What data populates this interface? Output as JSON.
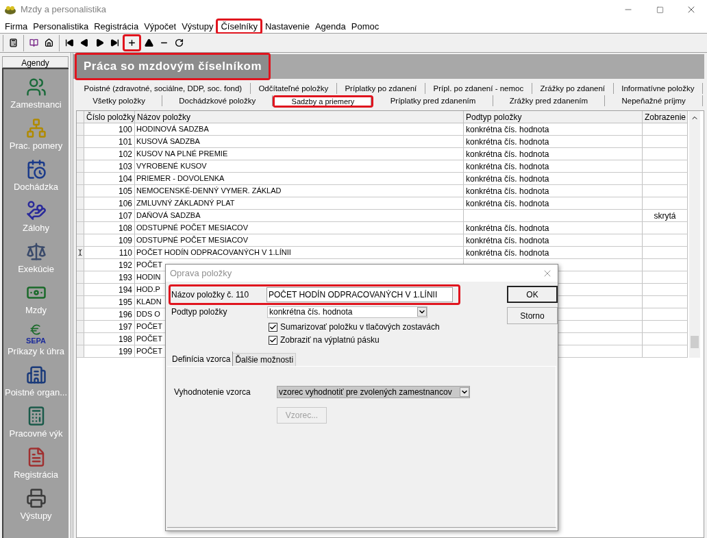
{
  "window": {
    "title": "Mzdy a personalistika"
  },
  "menu": [
    {
      "label": "Firma",
      "highlighted": false
    },
    {
      "label": "Personalistika",
      "highlighted": false
    },
    {
      "label": "Registrácia",
      "highlighted": false
    },
    {
      "label": "Výpočet",
      "highlighted": false
    },
    {
      "label": "Výstupy",
      "highlighted": false
    },
    {
      "label": "Číselníky",
      "highlighted": true
    },
    {
      "label": "Nastavenie",
      "highlighted": false
    },
    {
      "label": "Agenda",
      "highlighted": false
    },
    {
      "label": "Pomoc",
      "highlighted": false
    }
  ],
  "toolbar": {
    "groups": [
      {
        "buttons": [
          {
            "kind": "calculator",
            "highlighted": false
          }
        ]
      },
      {
        "buttons": [
          {
            "kind": "book",
            "highlighted": false
          },
          {
            "kind": "home",
            "highlighted": false
          }
        ]
      },
      {
        "buttons": [
          {
            "kind": "first",
            "highlighted": false
          },
          {
            "kind": "prev",
            "highlighted": false
          },
          {
            "kind": "next",
            "highlighted": false
          },
          {
            "kind": "last",
            "highlighted": false
          },
          {
            "kind": "add",
            "highlighted": true
          },
          {
            "kind": "up",
            "highlighted": false
          },
          {
            "kind": "remove",
            "highlighted": false
          },
          {
            "kind": "refresh",
            "highlighted": false
          }
        ]
      }
    ]
  },
  "sidebar": {
    "header": "Agendy",
    "items": [
      {
        "label": "Zamestnanci"
      },
      {
        "label": "Prac. pomery"
      },
      {
        "label": "Dochádzka"
      },
      {
        "label": "Zálohy"
      },
      {
        "label": "Exekúcie"
      },
      {
        "label": "Mzdy"
      },
      {
        "label": "Príkazy k úhra",
        "badge": "SEPA"
      },
      {
        "label": "Poistné organ..."
      },
      {
        "label": "Pracovné výk"
      },
      {
        "label": "Registrácia"
      },
      {
        "label": "Výstupy"
      }
    ]
  },
  "header": {
    "title": "Práca so mzdovým číselníkom",
    "highlighted": true
  },
  "tabs": {
    "upper": [
      {
        "label": "Poistné (zdravotné, sociálne, DDP, soc. fond)",
        "selected": false,
        "highlighted": false
      },
      {
        "label": "Odčítateľné položky",
        "selected": false,
        "highlighted": false
      },
      {
        "label": "Príplatky po zdanení",
        "selected": false,
        "highlighted": false
      },
      {
        "label": "Prípl. po zdanení - nemoc",
        "selected": false,
        "highlighted": false
      },
      {
        "label": "Zrážky po zdanení",
        "selected": false,
        "highlighted": false
      },
      {
        "label": "Informatívne položky",
        "selected": false,
        "highlighted": false
      }
    ],
    "lower": [
      {
        "label": "Všetky položky",
        "selected": false,
        "highlighted": false
      },
      {
        "label": "Dochádzkové položky",
        "selected": false,
        "highlighted": false
      },
      {
        "label": "Sadzby a priemery",
        "selected": true,
        "highlighted": true
      },
      {
        "label": "Príplatky pred zdanením",
        "selected": false,
        "highlighted": false
      },
      {
        "label": "Zrážky pred zdanením",
        "selected": false,
        "highlighted": false
      },
      {
        "label": "Nepeňažné príjmy",
        "selected": false,
        "highlighted": false
      }
    ]
  },
  "table": {
    "columns": [
      "Číslo položky",
      "Názov položky",
      "Podtyp položky",
      "Zobrazenie"
    ],
    "rows": [
      {
        "number": "100",
        "name": "HODINOVÁ SADZBA",
        "subtype": "konkrétna čís. hodnota",
        "current": false
      },
      {
        "number": "101",
        "name": "KUSOVÁ SADZBA",
        "subtype": "konkrétna čís. hodnota",
        "current": false
      },
      {
        "number": "102",
        "name": "KUSOV NA PLNÉ PREMIE",
        "subtype": "konkrétna čís. hodnota",
        "current": false
      },
      {
        "number": "103",
        "name": "VYROBENÉ KUSOV",
        "subtype": "konkrétna čís. hodnota",
        "current": false
      },
      {
        "number": "104",
        "name": "PRIEMER - DOVOLENKA",
        "subtype": "konkrétna čís. hodnota",
        "current": false
      },
      {
        "number": "105",
        "name": "NEMOCENSKÉ-DENNÝ VYMER. ZÁKLAD",
        "subtype": "konkrétna čís. hodnota",
        "current": false
      },
      {
        "number": "106",
        "name": "ZMLUVNÝ ZÁKLADNÝ PLAT",
        "subtype": "konkrétna čís. hodnota",
        "current": false
      },
      {
        "number": "107",
        "name": "DAŇOVÁ SADZBA",
        "display": "skrytá",
        "current": false
      },
      {
        "number": "108",
        "name": "ODSTUPNÉ POČET MESIACOV",
        "subtype": "konkrétna čís. hodnota",
        "current": false
      },
      {
        "number": "109",
        "name": "ODSTUPNÉ POČET MESIACOV",
        "subtype": "konkrétna čís. hodnota",
        "current": false
      },
      {
        "number": "110",
        "name": "POČET HODÍN ODPRACOVANÝCH V 1.LÍNII",
        "subtype": "konkrétna čís. hodnota",
        "current": true
      },
      {
        "number": "192",
        "name": "POČET",
        "current": false
      },
      {
        "number": "193",
        "name": "HODIN",
        "current": false
      },
      {
        "number": "194",
        "name": "HOD.P",
        "current": false
      },
      {
        "number": "195",
        "name": "KLADN",
        "current": false
      },
      {
        "number": "196",
        "name": "DDS O",
        "current": false
      },
      {
        "number": "197",
        "name": "POČET",
        "current": false
      },
      {
        "number": "198",
        "name": "POČET",
        "current": false
      },
      {
        "number": "199",
        "name": "POČET",
        "current": false
      }
    ]
  },
  "dialog": {
    "title": "Oprava položky",
    "name_label": "Názov položky č.  110",
    "name_value": "POČET HODÍN ODPRACOVANÝCH V 1.LÍNII",
    "name_highlighted": true,
    "subtype_label": "Podtyp položky",
    "subtype_value": "konkrétna čís. hodnota",
    "checkboxes": [
      {
        "label": "Sumarizovať položku v tlačových zostavách",
        "checked": true
      },
      {
        "label": "Zobraziť na výplatnú pásku",
        "checked": true
      }
    ],
    "buttons": [
      {
        "label": "OK",
        "default": true
      },
      {
        "label": "Storno",
        "default": false
      }
    ],
    "tabs": [
      {
        "label": "Definícia vzorca",
        "selected": true
      },
      {
        "label": "Ďalšie možnosti",
        "selected": false
      }
    ],
    "formula_label": "Vyhodnotenie vzorca",
    "formula_value": "vzorec vyhodnotiť pre zvolených zamestnancov",
    "formula_button": {
      "label": "Vzorec...",
      "disabled": true
    }
  }
}
